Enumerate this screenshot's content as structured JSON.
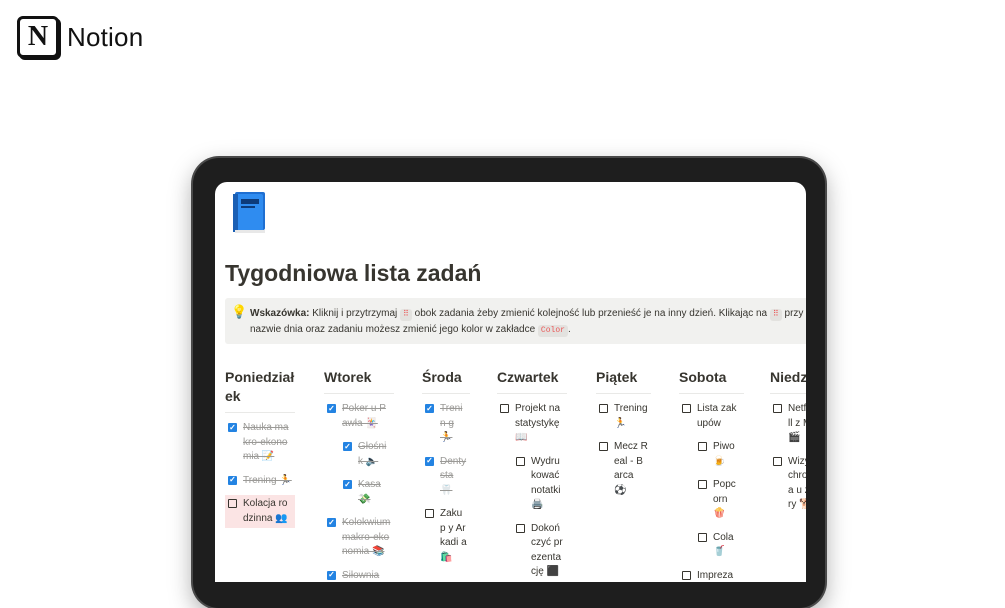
{
  "brand": {
    "name": "Notion",
    "logo_letter": "N"
  },
  "page": {
    "title": "Tygodniowa lista zadań",
    "icon": "blue-book-icon"
  },
  "callout": {
    "icon": "lightbulb-icon",
    "bold": "Wskazówka:",
    "part1": " Kliknij i przytrzymaj ",
    "token1": "⠿",
    "part2": " obok zadania żeby zmienić kolejność lub przenieść je na inny dzień. Klikając na ",
    "token2": "⠿",
    "part3": " przy nazwie dnia oraz zadaniu możesz zmienić jego kolor w zakładce ",
    "token3": "Color",
    "part4": "."
  },
  "days": [
    {
      "name": "Poniedział\nek",
      "tasks": [
        {
          "text": "Nauka makro-ekonomia 📝",
          "done": true
        },
        {
          "text": "Trening 🏃",
          "done": true
        },
        {
          "text": "Kolacja rodzinna 👥",
          "done": false,
          "highlight": "pink"
        }
      ]
    },
    {
      "name": "Wtorek",
      "tasks": [
        {
          "text": "Poker u Pawła 🃏",
          "done": true
        },
        {
          "text": "Głośnik 🔈",
          "done": true,
          "sub": true
        },
        {
          "text": "Kasa 💸",
          "done": true,
          "sub": true
        },
        {
          "text": "Kolokwium makro-ekonomia 📚",
          "done": true
        },
        {
          "text": "Siłownia 💪",
          "done": true
        }
      ]
    },
    {
      "name": "Środa",
      "tasks": [
        {
          "text": "Trenin g 🏃",
          "done": true
        },
        {
          "text": "Denty sta 🦷",
          "done": true
        },
        {
          "text": "Zakup y Arkadi a 🛍️",
          "done": false
        }
      ]
    },
    {
      "name": "Czwartek",
      "tasks": [
        {
          "text": "Projekt na statystykę 📖",
          "done": false
        },
        {
          "text": "Wydrukować notatki 🖨️",
          "done": false,
          "sub": true
        },
        {
          "text": "Dokończyć prezentację ⬛",
          "done": false,
          "sub": true
        }
      ]
    },
    {
      "name": "Piątek",
      "tasks": [
        {
          "text": "Trening 🏃",
          "done": false
        },
        {
          "text": "Mecz Real - Barca ⚽",
          "done": false
        }
      ]
    },
    {
      "name": "Sobota",
      "tasks": [
        {
          "text": "Lista zakupów",
          "done": false
        },
        {
          "text": "Piwo 🍺",
          "done": false,
          "sub": true
        },
        {
          "text": "Popcorn 🍿",
          "done": false,
          "sub": true
        },
        {
          "text": "Cola 🥤",
          "done": false,
          "sub": true
        },
        {
          "text": "Impreza u Tomka",
          "done": false
        }
      ]
    },
    {
      "name": "Niedziela",
      "tasks": [
        {
          "text": "Netflix hill z Mary 🎬",
          "done": false
        },
        {
          "text": "Wizyta schroniska u z Mary 🐕",
          "done": false
        }
      ]
    }
  ],
  "colors": {
    "checkbox_checked": "#2383e2",
    "callout_bg": "#f1f1ef",
    "highlight_pink": "#fbe4e4",
    "token_red": "#eb5757"
  }
}
